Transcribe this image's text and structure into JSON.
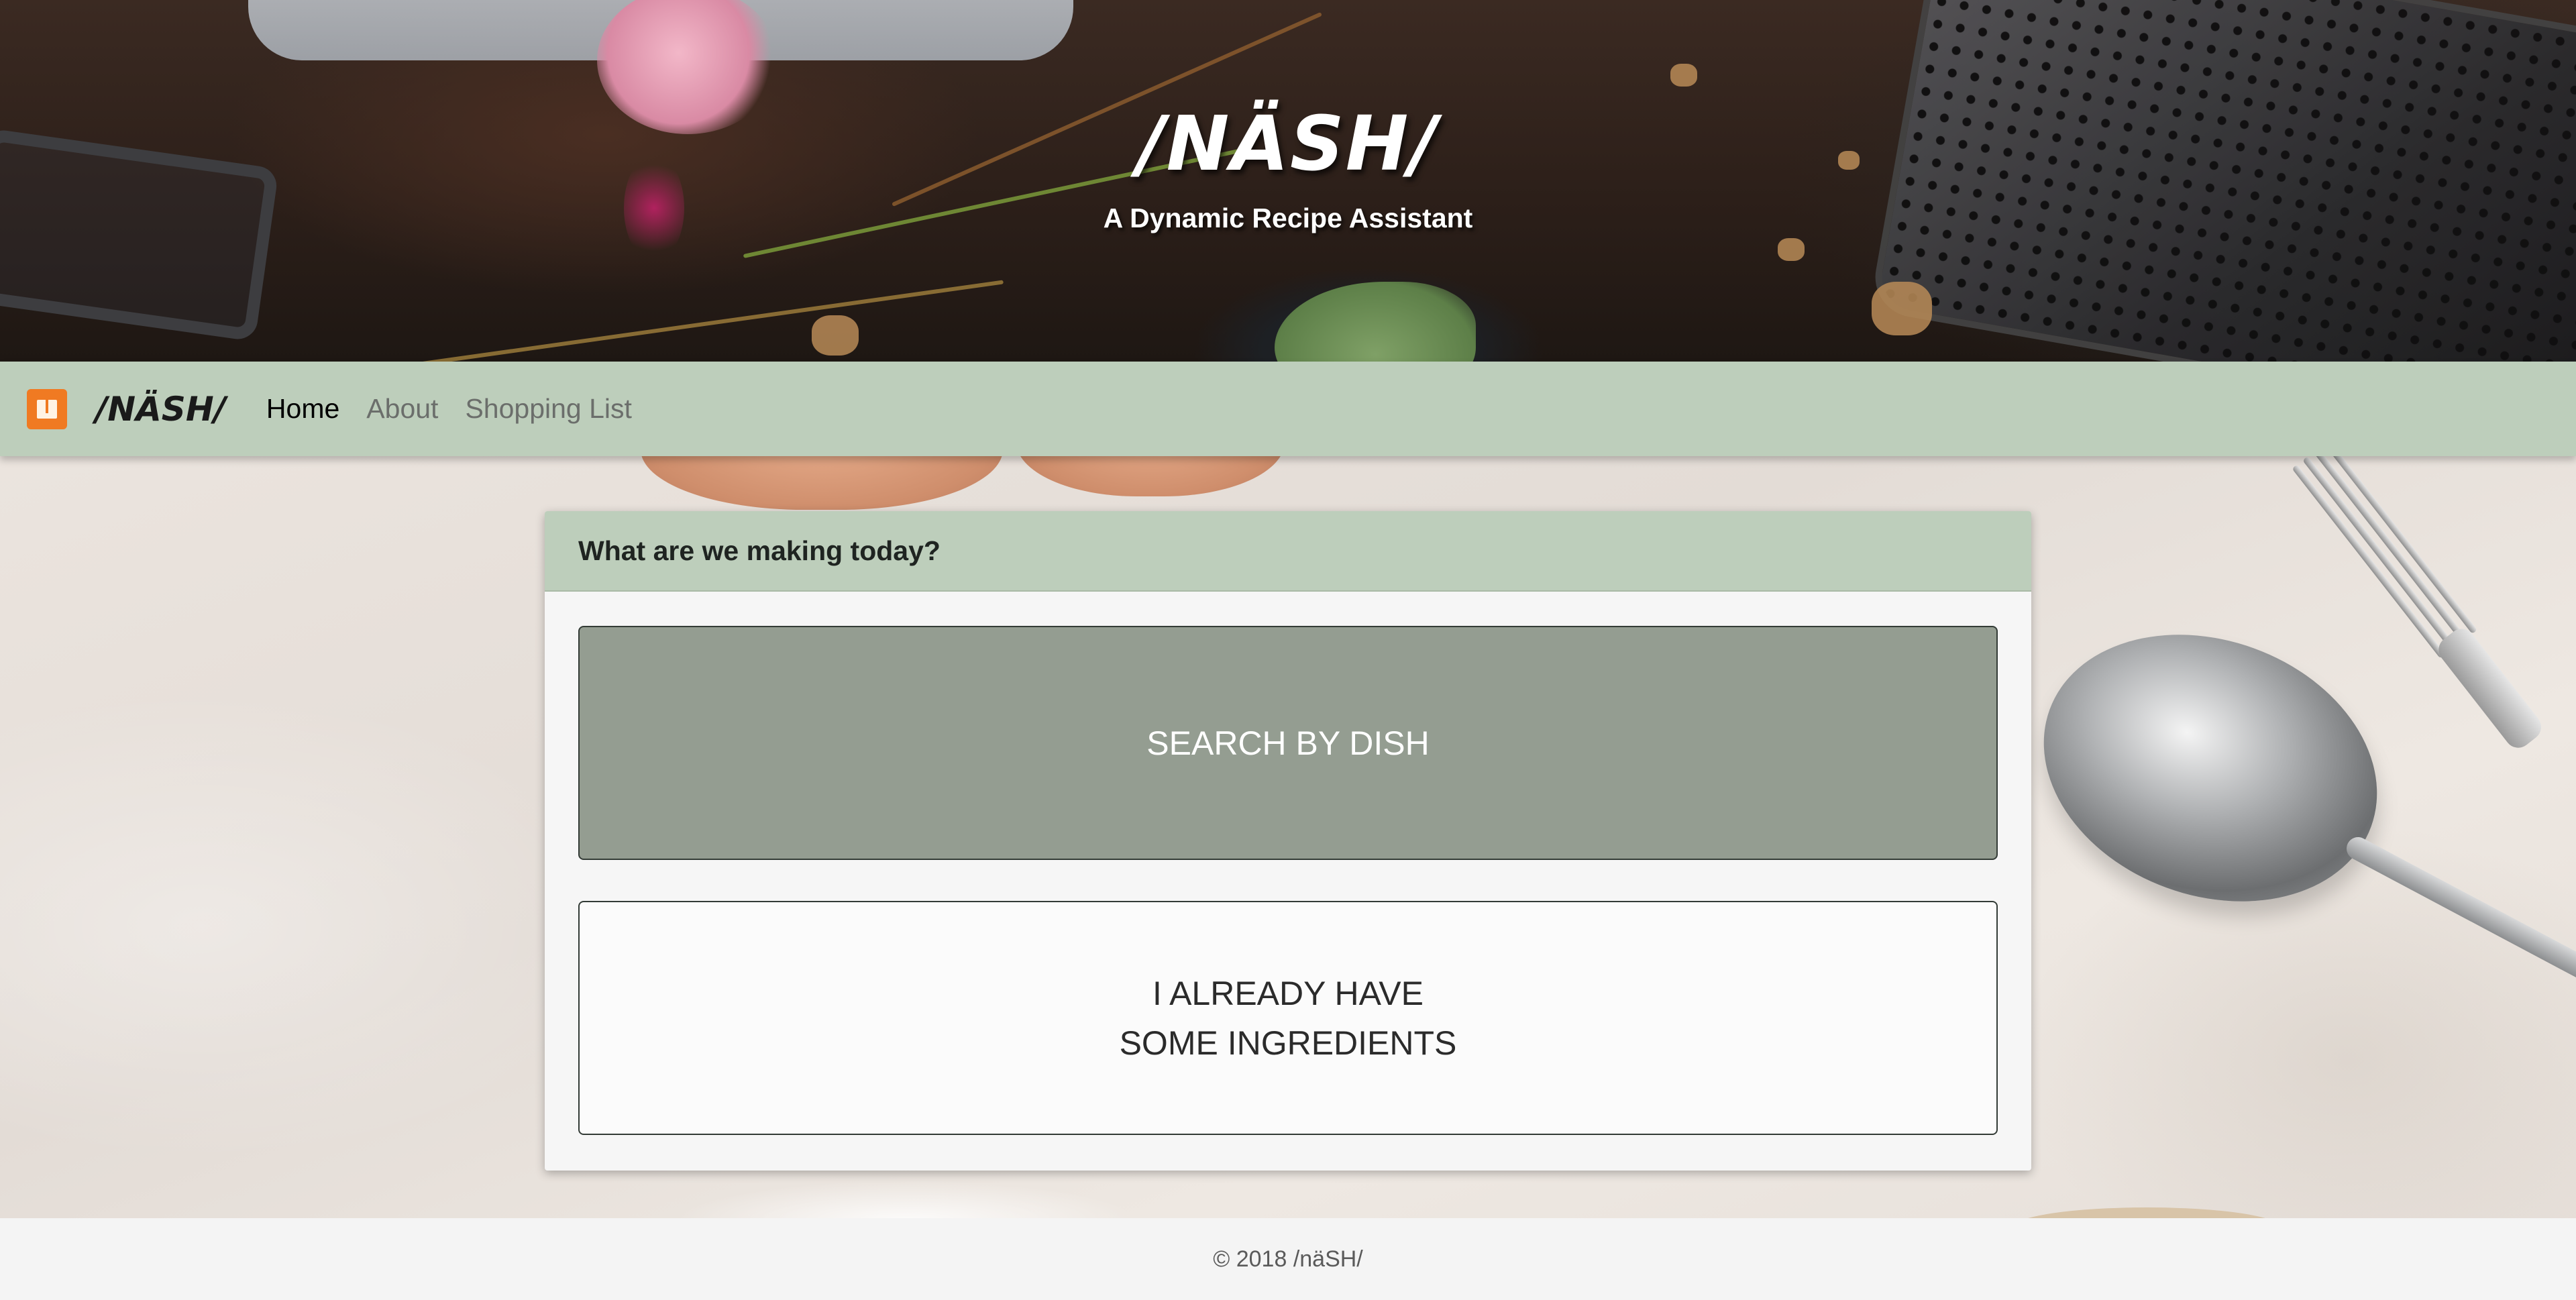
{
  "hero": {
    "title": "/NÄSH/",
    "tagline": "A Dynamic Recipe Assistant"
  },
  "navbar": {
    "logo_icon": "book-icon",
    "brand": "/NÄSH/",
    "links": [
      {
        "label": "Home",
        "active": true
      },
      {
        "label": "About",
        "active": false
      },
      {
        "label": "Shopping List",
        "active": false
      }
    ]
  },
  "card": {
    "header": "What are we making today?",
    "search_by_dish": "SEARCH BY DISH",
    "ingredients_line1": "I ALREADY HAVE",
    "ingredients_line2": "SOME INGREDIENTS"
  },
  "footer": {
    "text": "© 2018 /näSH/"
  },
  "colors": {
    "nav_bg": "#bdcebb",
    "primary_button": "#949d91",
    "logo_orange": "#f07a22"
  }
}
